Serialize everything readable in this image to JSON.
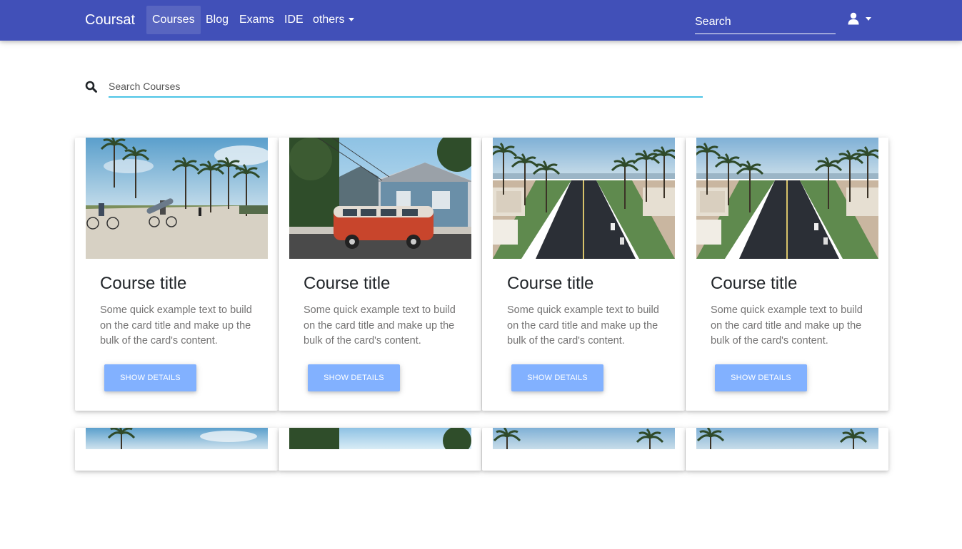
{
  "navbar": {
    "brand": "Coursat",
    "items": [
      {
        "label": "Courses",
        "active": true
      },
      {
        "label": "Blog",
        "active": false
      },
      {
        "label": "Exams",
        "active": false
      },
      {
        "label": "IDE",
        "active": false
      },
      {
        "label": "others",
        "active": false,
        "dropdown": true
      }
    ],
    "search_placeholder": "Search",
    "user_icon": "user-icon"
  },
  "course_search": {
    "icon": "search-icon",
    "placeholder": "Search Courses"
  },
  "cards": [
    {
      "image": "beach-bikes",
      "title": "Course title",
      "text": "Some quick example text to build on the card title and make up the bulk of the card's content.",
      "button": "Show details"
    },
    {
      "image": "red-van",
      "title": "Course title",
      "text": "Some quick example text to build on the card title and make up the bulk of the card's content.",
      "button": "Show details"
    },
    {
      "image": "palm-street",
      "title": "Course title",
      "text": "Some quick example text to build on the card title and make up the bulk of the card's content.",
      "button": "Show details"
    },
    {
      "image": "palm-street",
      "title": "Course title",
      "text": "Some quick example text to build on the card title and make up the bulk of the card's content.",
      "button": "Show details"
    }
  ],
  "colors": {
    "navbar": "#4150b8",
    "button": "#82b1ff",
    "search_underline": "#4dc4e6"
  }
}
